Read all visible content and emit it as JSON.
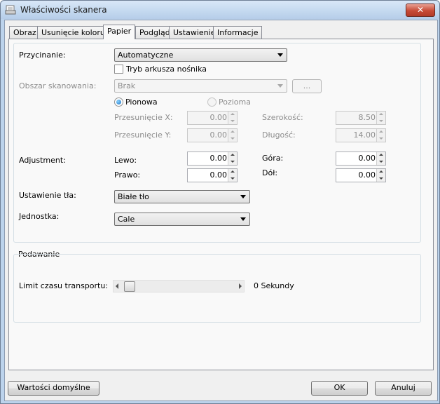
{
  "window": {
    "title": "Właściwości skanera",
    "close_glyph": "✕"
  },
  "tabs": [
    {
      "label": "Obraz"
    },
    {
      "label": "Usunięcie koloru"
    },
    {
      "label": "Papier",
      "active": true
    },
    {
      "label": "Podgląd"
    },
    {
      "label": "Ustawienie"
    },
    {
      "label": "Informacje"
    }
  ],
  "paper": {
    "cropping_label": "Przycinanie:",
    "cropping_value": "Automatyczne",
    "carrier_checkbox_label": "Tryb arkusza nośnika",
    "carrier_checked": false,
    "scan_area_label": "Obszar skanowania:",
    "scan_area_value": "Brak",
    "scan_area_button": "...",
    "orientation_portrait": "Pionowa",
    "orientation_landscape": "Pozioma",
    "orientation_selected": "Pionowa",
    "offset_x_label": "Przesunięcie X:",
    "offset_x_value": "0.00",
    "offset_y_label": "Przesunięcie Y:",
    "offset_y_value": "0.00",
    "width_label": "Szerokość:",
    "width_value": "8.50",
    "length_label": "Długość:",
    "length_value": "14.00",
    "adjustment_label": "Adjustment:",
    "left_label": "Lewo:",
    "left_value": "0.00",
    "top_label": "Góra:",
    "top_value": "0.00",
    "right_label": "Prawo:",
    "right_value": "0.00",
    "bottom_label": "Dół:",
    "bottom_value": "0.00",
    "background_label": "Ustawienie tła:",
    "background_value": "Białe tło",
    "unit_label": "Jednostka:",
    "unit_value": "Cale"
  },
  "feeding": {
    "group_title": "Podawanie",
    "timeout_label": "Limit czasu transportu:",
    "timeout_value": "0 Sekundy",
    "slider_fraction": 0
  },
  "footer": {
    "defaults_button": "Wartości domyślne",
    "ok_button": "OK",
    "cancel_button": "Anuluj"
  }
}
